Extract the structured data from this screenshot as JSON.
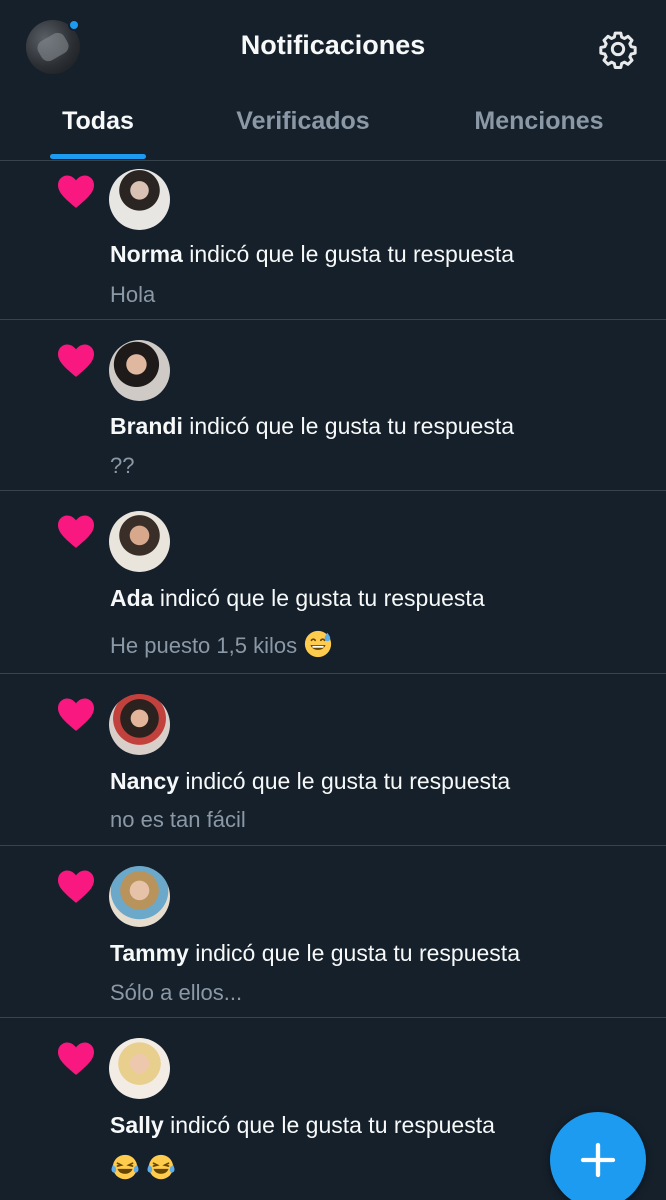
{
  "header": {
    "title": "Notificaciones",
    "profile_icon": "profile-avatar",
    "settings_icon": "gear-icon"
  },
  "tabs": [
    {
      "label": "Todas",
      "active": true
    },
    {
      "label": "Verificados",
      "active": false
    },
    {
      "label": "Menciones",
      "active": false
    }
  ],
  "notifications": [
    {
      "icon": "heart-icon",
      "name": "Norma",
      "action": " indicó que le gusta tu respuesta",
      "snippet": "Hola"
    },
    {
      "icon": "heart-icon",
      "name": "Brandi",
      "action": " indicó que le gusta tu respuesta",
      "snippet": "??"
    },
    {
      "icon": "heart-icon",
      "name": "Ada",
      "action": " indicó que le gusta tu respuesta",
      "snippet": "He puesto 1,5 kilos",
      "snippet_emoji": "sweat-smile-emoji"
    },
    {
      "icon": "heart-icon",
      "name": "Nancy",
      "action": " indicó que le gusta tu respuesta",
      "snippet": "no es tan fácil"
    },
    {
      "icon": "heart-icon",
      "name": "Tammy",
      "action": " indicó que le gusta tu respuesta",
      "snippet": "Sólo a ellos..."
    },
    {
      "icon": "heart-icon",
      "name": "Sally",
      "action": " indicó que le gusta tu respuesta",
      "snippet": "",
      "snippet_emoji": "tears-of-joy-emoji x2"
    }
  ],
  "fab": {
    "icon": "plus-icon"
  },
  "colors": {
    "background": "#15202b",
    "accent": "#1d9bf0",
    "heart": "#f91880",
    "muted_text": "#8b98a5",
    "divider": "#38444d"
  }
}
